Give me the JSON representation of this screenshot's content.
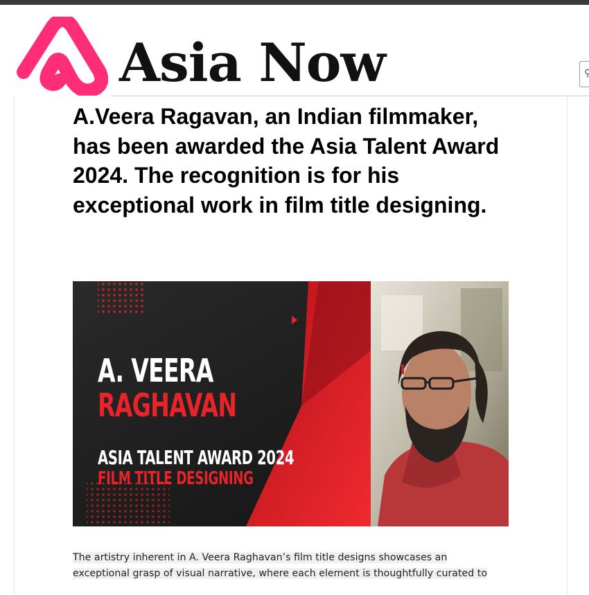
{
  "site": {
    "name": "Asia Now",
    "logo_color": "#ff2d78"
  },
  "search": {
    "icon": "search-icon"
  },
  "article": {
    "headline": "A.Veera Ragavan, an Indian filmmaker, has been awarded the Asia Talent Award 2024. The recognition is for his exceptional work in film title designing.",
    "hero_image": {
      "name_line1": "A. VEERA",
      "name_line2": "RAGHAVAN",
      "award_line1": "ASIA TALENT AWARD 2024",
      "award_line2": "FILM TITLE DESIGNING"
    },
    "body_line1": "The artistry inherent in A. Veera Raghavan’s film title designs showcases an",
    "body_line2": "exceptional grasp of visual narrative, where each element is thoughtfully curated to"
  },
  "colors": {
    "accent_red": "#e8232a",
    "hero_dark": "#1c1c1c"
  }
}
